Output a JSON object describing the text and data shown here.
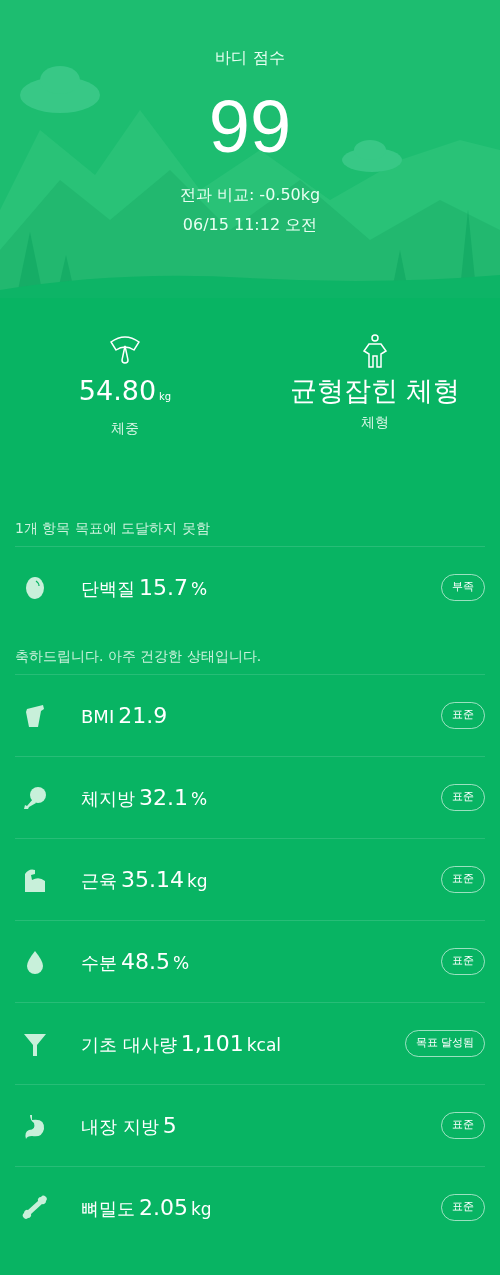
{
  "score": {
    "title": "바디 점수",
    "value": "99",
    "comparison": "전과 비교: -0.50kg",
    "timestamp": "06/15 11:12 오전"
  },
  "summary": [
    {
      "kind": "weight",
      "value": "54.80",
      "unit": "kg",
      "label": "체중"
    },
    {
      "kind": "body_type",
      "value": "균형잡힌 체형",
      "label": "체형"
    }
  ],
  "sections": [
    {
      "heading": "1개 항목 목표에 도달하지 못함",
      "metrics": [
        {
          "kind": "protein",
          "name": "단백질",
          "value": "15.7",
          "unit": "%",
          "status": "부족"
        }
      ]
    },
    {
      "heading": "축하드립니다. 아주 건강한 상태입니다.",
      "metrics": [
        {
          "kind": "bmi",
          "name": "BMI",
          "value": "21.9",
          "status": "표준"
        },
        {
          "kind": "fat",
          "name": "체지방",
          "value": "32.1",
          "unit": "%",
          "status": "표준"
        },
        {
          "kind": "muscle",
          "name": "근육",
          "value": "35.14",
          "unit": "kg",
          "status": "표준"
        },
        {
          "kind": "water",
          "name": "수분",
          "value": "48.5",
          "unit": "%",
          "status": "표준"
        },
        {
          "kind": "bmr",
          "name": "기초 대사량",
          "value": "1,101",
          "unit": "kcal",
          "status": "목표 달성됨"
        },
        {
          "kind": "visceral",
          "name": "내장 지방",
          "value": "5",
          "status": "표준"
        },
        {
          "kind": "bone",
          "name": "뼈밀도",
          "value": "2.05",
          "unit": "kg",
          "status": "표준"
        }
      ]
    }
  ]
}
